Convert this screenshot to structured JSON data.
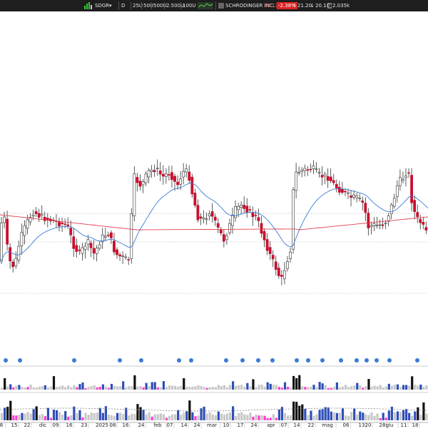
{
  "toolbar": {
    "symbol": "SDGR",
    "period": "D",
    "ranges": [
      "25U",
      "50U",
      "500U",
      "2.500U",
      "100U"
    ],
    "company": "SCHRODINGER INC.",
    "last": "20.12",
    "change": "-2.38%",
    "high": "21.20",
    "low": "20.10",
    "volume": "2.035k",
    "up_arrow": "↑",
    "down_arrow": "↓"
  },
  "colors": {
    "up": "#ffffff",
    "down": "#c8102e",
    "wick": "#333333",
    "ma_fast": "#3a7bd5",
    "ma_slow": "#e0424d",
    "vol_black": "#111111",
    "vol_blue": "#2f4fb8",
    "vol_grey": "#c8c8c8",
    "vol_pink": "#ff3fd0"
  },
  "date_labels": [
    "8",
    "15",
    "22",
    "dic",
    "09",
    "16",
    "23",
    "2025",
    "08",
    "16",
    "24",
    "feb",
    "07",
    "14",
    "24",
    "mar",
    "10",
    "17",
    "24",
    "apr",
    "07",
    "14",
    "22",
    "mag",
    "06",
    "13",
    "20",
    "28",
    "giu",
    "11",
    "18"
  ],
  "chart_data": {
    "type": "candlestick",
    "series": [
      {
        "values": []
      },
      {
        "values": []
      },
      {
        "values": []
      }
    ]
  }
}
